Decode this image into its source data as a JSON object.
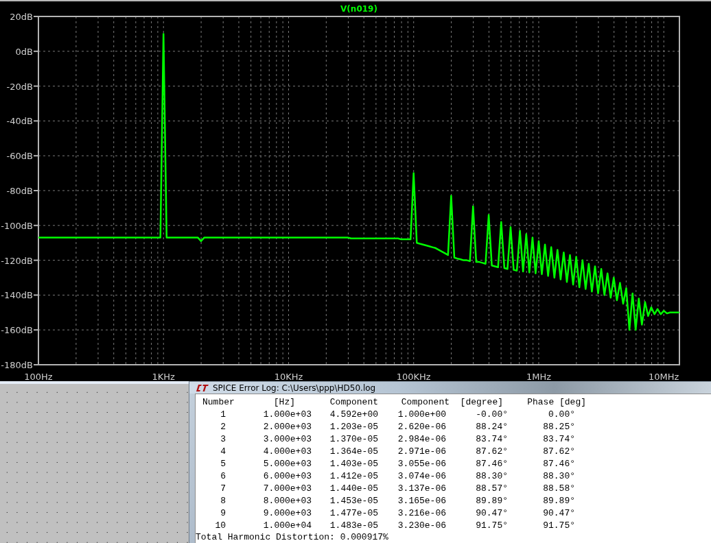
{
  "plot": {
    "chart_data": {
      "type": "line",
      "grid": true,
      "ylim": [
        -180,
        20
      ],
      "categories": [
        "100Hz",
        null,
        null,
        null,
        null,
        null,
        null,
        null,
        null,
        null,
        null,
        null,
        null,
        null,
        null,
        null,
        null,
        null,
        null,
        null,
        null,
        null,
        null,
        null,
        null,
        null,
        null,
        null,
        null,
        null,
        null,
        null,
        null,
        null,
        null,
        null,
        null,
        null,
        null,
        null,
        "1KHz",
        null,
        null,
        null,
        null,
        null,
        null,
        null,
        null,
        null,
        null,
        null,
        null,
        null,
        null,
        null,
        null,
        null,
        null,
        null,
        null,
        null,
        null,
        null,
        null,
        null,
        null,
        null,
        null,
        null,
        null,
        null,
        null,
        null,
        null,
        null,
        null,
        null,
        null,
        null,
        "10KHz",
        null,
        null,
        null,
        null,
        null,
        null,
        null,
        null,
        null,
        null,
        null,
        null,
        null,
        null,
        null,
        null,
        null,
        null,
        null,
        null,
        null,
        null,
        null,
        null,
        null,
        null,
        null,
        null,
        null,
        null,
        null,
        null,
        null,
        null,
        null,
        null,
        null,
        null,
        null,
        "100KHz",
        null,
        null,
        null,
        null,
        null,
        null,
        null,
        null,
        null,
        null,
        null,
        null,
        null,
        null,
        null,
        null,
        null,
        null,
        null,
        null,
        null,
        null,
        null,
        null,
        null,
        null,
        null,
        null,
        null,
        null,
        null,
        null,
        null,
        null,
        null,
        null,
        null,
        null,
        null,
        "1MHz",
        null,
        null,
        null,
        null,
        null,
        null,
        null,
        null,
        null,
        null,
        null,
        null,
        null,
        null,
        null,
        null,
        null,
        null,
        null,
        null,
        null,
        null,
        null,
        null,
        null,
        null,
        null,
        null,
        null,
        null,
        null,
        null,
        null,
        null,
        null,
        null,
        null,
        null,
        null,
        "10MHz",
        null,
        null,
        null,
        null,
        null
      ],
      "yticks": [
        {
          "value": 20,
          "label": "20dB"
        },
        {
          "value": 0,
          "label": "0dB"
        },
        {
          "value": -20,
          "label": "-20dB"
        },
        {
          "value": -40,
          "label": "-40dB"
        },
        {
          "value": -60,
          "label": "-60dB"
        },
        {
          "value": -80,
          "label": "-80dB"
        },
        {
          "value": -100,
          "label": "-100dB"
        },
        {
          "value": -120,
          "label": "-120dB"
        },
        {
          "value": -140,
          "label": "-140dB"
        },
        {
          "value": -160,
          "label": "-160dB"
        },
        {
          "value": -180,
          "label": "-180dB"
        }
      ],
      "series": [
        {
          "name": "V(n019)",
          "color": "#00ff00",
          "values": [
            -107,
            -107,
            -107,
            -107,
            -107,
            -107,
            -107,
            -107,
            -107,
            -107,
            -107,
            -107,
            -107,
            -107,
            -107,
            -107,
            -107,
            -107,
            -107,
            -107,
            -107,
            -107,
            -107,
            -107,
            -107,
            -107,
            -107,
            -107,
            -107,
            -107,
            -107,
            -107,
            -107,
            -107,
            -107,
            -107,
            -107,
            -107,
            -107,
            -107,
            10,
            -107,
            -107,
            -107,
            -107,
            -107,
            -107,
            -107,
            -107,
            -107,
            -107,
            -107,
            -109,
            -107,
            -107,
            -107,
            -107,
            -107,
            -107,
            -107,
            -107,
            -107,
            -107,
            -107,
            -107,
            -107,
            -107,
            -107,
            -107,
            -107,
            -107,
            -107,
            -107,
            -107,
            -107,
            -107,
            -107,
            -107,
            -107,
            -107,
            -107,
            -107,
            -107,
            -107,
            -107,
            -107,
            -107,
            -107,
            -107,
            -107,
            -107,
            -107,
            -107,
            -107,
            -107,
            -107,
            -107,
            -107,
            -107,
            -107,
            -107.5,
            -107.5,
            -107.5,
            -107.5,
            -107.5,
            -107.5,
            -107.5,
            -107.5,
            -107.5,
            -107.5,
            -107.5,
            -107.5,
            -107.5,
            -107.5,
            -107.5,
            -107.5,
            -108,
            -108,
            -108,
            -108,
            -70,
            -110,
            -110.5,
            -111,
            -111.5,
            -112,
            -112.5,
            -113,
            -114,
            -115,
            -116,
            -117,
            -83,
            -118.5,
            -119,
            -119.5,
            -120,
            -120,
            -120.5,
            -89,
            -121,
            -121,
            -121.5,
            -122,
            -94,
            -123,
            -123.5,
            -124,
            -98,
            -124.5,
            -125,
            -101,
            -125.5,
            -126,
            -103,
            -126.5,
            -105,
            -127,
            -107,
            -127.5,
            -109,
            -128,
            -111,
            -129,
            -112.5,
            -130,
            -114,
            -131,
            -115.5,
            -132.5,
            -117,
            -134,
            -118,
            -135.5,
            -120,
            -136.5,
            -122,
            -138,
            -123.5,
            -139,
            -125,
            -140,
            -127.5,
            -141.5,
            -130,
            -143,
            -133,
            -145,
            -136,
            -160,
            -139,
            -160,
            -142,
            -157,
            -144,
            -152,
            -147,
            -151,
            -148,
            -151,
            -149,
            -150.5,
            -150,
            -150,
            -150,
            -150
          ]
        }
      ]
    }
  },
  "log_window": {
    "title": "SPICE Error Log: C:\\Users\\ppp\\HD50.log",
    "columns": [
      "Number",
      "[Hz]",
      "Component",
      "Component",
      "[degree]",
      "Phase [deg]"
    ],
    "rows": [
      [
        "1",
        "1.000e+03",
        "4.592e+00",
        "1.000e+00",
        "-0.00°",
        "0.00°"
      ],
      [
        "2",
        "2.000e+03",
        "1.203e-05",
        "2.620e-06",
        "88.24°",
        "88.25°"
      ],
      [
        "3",
        "3.000e+03",
        "1.370e-05",
        "2.984e-06",
        "83.74°",
        "83.74°"
      ],
      [
        "4",
        "4.000e+03",
        "1.364e-05",
        "2.971e-06",
        "87.62°",
        "87.62°"
      ],
      [
        "5",
        "5.000e+03",
        "1.403e-05",
        "3.055e-06",
        "87.46°",
        "87.46°"
      ],
      [
        "6",
        "6.000e+03",
        "1.412e-05",
        "3.074e-06",
        "88.30°",
        "88.30°"
      ],
      [
        "7",
        "7.000e+03",
        "1.440e-05",
        "3.137e-06",
        "88.57°",
        "88.58°"
      ],
      [
        "8",
        "8.000e+03",
        "1.453e-05",
        "3.165e-06",
        "89.89°",
        "89.89°"
      ],
      [
        "9",
        "9.000e+03",
        "1.477e-05",
        "3.216e-06",
        "90.47°",
        "90.47°"
      ],
      [
        "10",
        "1.000e+04",
        "1.483e-05",
        "3.230e-06",
        "91.75°",
        "91.75°"
      ]
    ],
    "footer": "Total Harmonic Distortion: 0.000917%"
  }
}
